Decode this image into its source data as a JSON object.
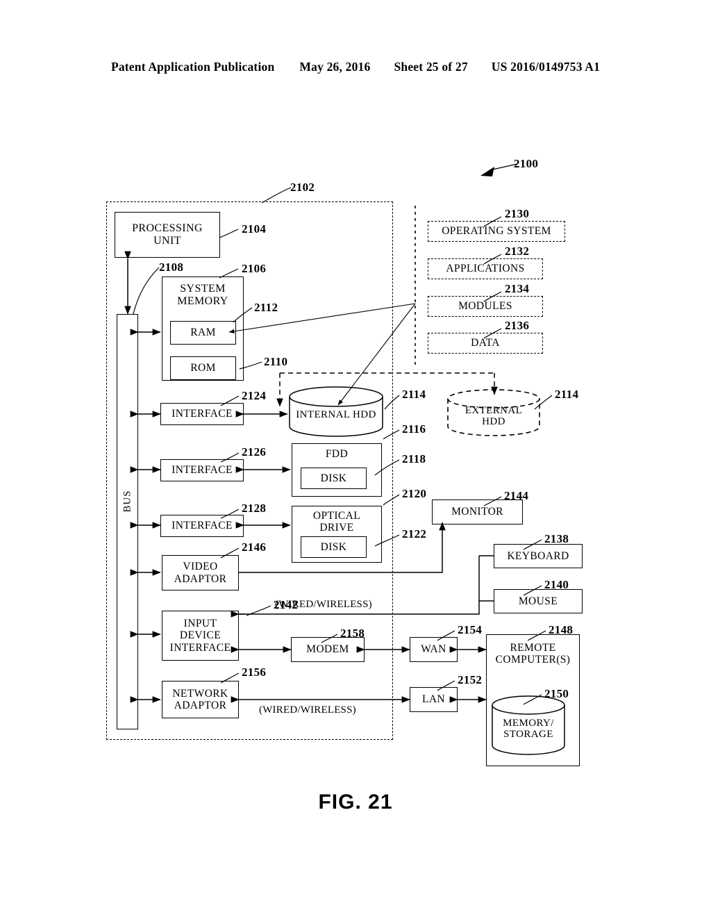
{
  "header": {
    "publication": "Patent Application Publication",
    "date": "May 26, 2016",
    "sheet": "Sheet 25 of 27",
    "docnum": "US 2016/0149753 A1"
  },
  "figure": {
    "caption": "FIG. 21"
  },
  "refs": {
    "system": "2100",
    "computer": "2102",
    "processing_unit": "2104",
    "system_memory": "2106",
    "bus": "2108",
    "rom": "2110",
    "ram": "2112",
    "internal_hdd": "2114",
    "external_hdd": "2114",
    "fdd": "2116",
    "fdd_disk": "2118",
    "optical_drive": "2120",
    "optical_disk": "2122",
    "interface_hdd": "2124",
    "interface_fdd": "2126",
    "interface_optical": "2128",
    "operating_system": "2130",
    "applications": "2132",
    "modules": "2134",
    "data": "2136",
    "keyboard": "2138",
    "mouse": "2140",
    "input_device_interface": "2142",
    "monitor": "2144",
    "video_adaptor": "2146",
    "remote_computers": "2148",
    "memory_storage": "2150",
    "lan": "2152",
    "wan": "2154",
    "network_adaptor": "2156",
    "modem": "2158"
  },
  "blocks": {
    "processing_unit": "PROCESSING\nUNIT",
    "system_memory": "SYSTEM\nMEMORY",
    "ram": "RAM",
    "rom": "ROM",
    "bus": "BUS",
    "interface_hdd": "INTERFACE",
    "interface_fdd": "INTERFACE",
    "interface_optical": "INTERFACE",
    "video_adaptor": "VIDEO\nADAPTOR",
    "input_device_interface": "INPUT\nDEVICE\nINTERFACE",
    "network_adaptor": "NETWORK\nADAPTOR",
    "internal_hdd": "INTERNAL HDD",
    "external_hdd": "EXTERNAL\nHDD",
    "fdd": "FDD",
    "fdd_disk": "DISK",
    "optical_drive": "OPTICAL\nDRIVE",
    "optical_disk": "DISK",
    "monitor": "MONITOR",
    "keyboard": "KEYBOARD",
    "mouse": "MOUSE",
    "modem": "MODEM",
    "wan": "WAN",
    "lan": "LAN",
    "remote_computers": "REMOTE\nCOMPUTER(S)",
    "memory_storage": "MEMORY/\nSTORAGE",
    "operating_system": "OPERATING SYSTEM",
    "applications": "APPLICATIONS",
    "modules": "MODULES",
    "data": "DATA"
  },
  "annotations": {
    "wired_wireless_top": "(WIRED/WIRELESS)",
    "wired_wireless_bottom": "(WIRED/WIRELESS)"
  },
  "colors": {
    "ink": "#000000",
    "paper": "#ffffff"
  }
}
